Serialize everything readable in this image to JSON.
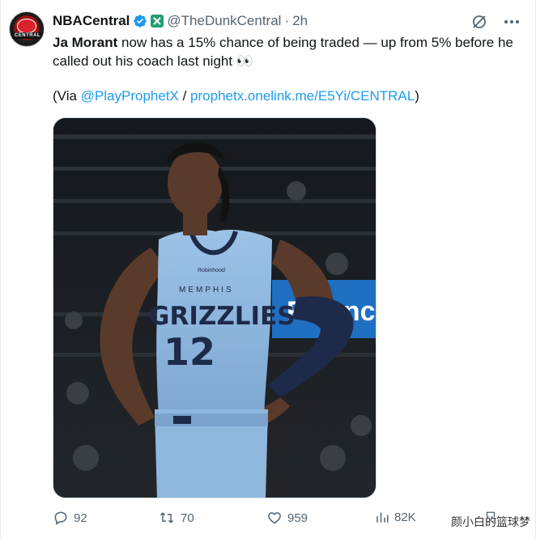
{
  "account": {
    "display_name": "NBACentral",
    "handle": "@TheDunkCentral",
    "separator": "·",
    "time": "2h",
    "avatar_text": "CENTRAL"
  },
  "tweet": {
    "bold_name": "Ja Morant",
    "body": " now has a 15% chance of being traded — up from 5% before he called out his coach last night 👀",
    "via_prefix": "(Via ",
    "via_mention": "@PlayProphetX",
    "via_sep": " / ",
    "via_link": "prophetx.onelink.me/E5Yi/CENTRAL",
    "via_suffix": ")"
  },
  "media": {
    "jersey_team": "GRIZZLIES",
    "jersey_city": "MEMPHIS",
    "jersey_number": "12",
    "sponsor": "Robinhood",
    "banner_text": "Finance"
  },
  "actions": {
    "replies": "92",
    "reposts": "70",
    "likes": "959",
    "views": "82K"
  },
  "watermark": "颜小白的篮球梦",
  "colors": {
    "link": "#1d9bf0",
    "muted": "#536471",
    "verified": "#1d9bf0",
    "jersey": "#8fb7de",
    "navy": "#1e2a4a"
  }
}
